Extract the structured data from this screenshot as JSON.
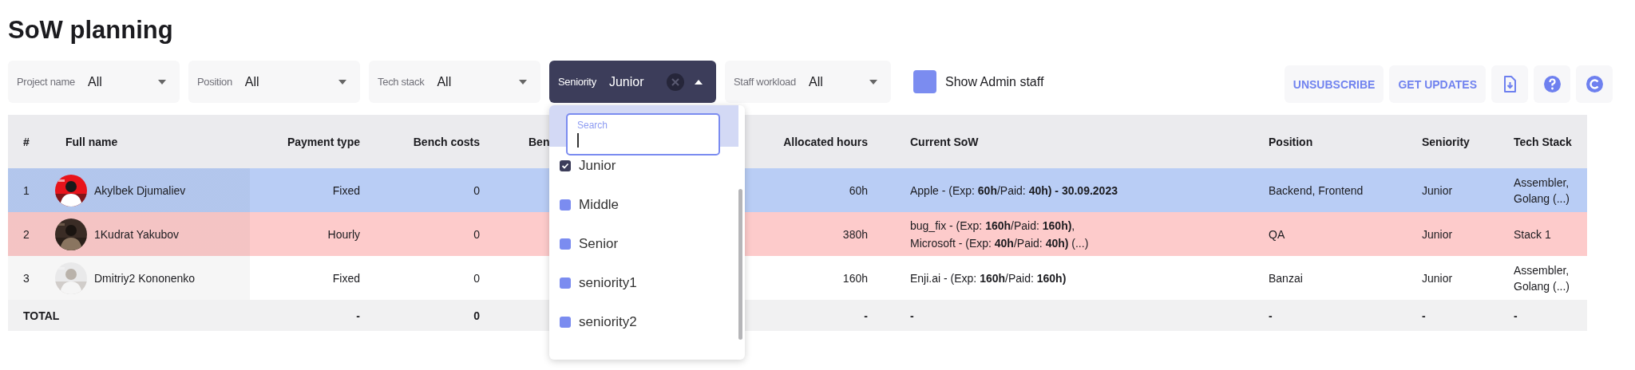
{
  "page": {
    "title": "SoW planning"
  },
  "filters": [
    {
      "label": "Project name",
      "value": "All",
      "open": false
    },
    {
      "label": "Position",
      "value": "All",
      "open": false
    },
    {
      "label": "Tech stack",
      "value": "All",
      "open": false
    },
    {
      "label": "Seniority",
      "value": "Junior",
      "open": true
    },
    {
      "label": "Staff workload",
      "value": "All",
      "open": false
    }
  ],
  "show_admin_staff": {
    "label": "Show Admin staff",
    "checked": false
  },
  "actions": [
    "UNSUBSCRIBE",
    "GET UPDATES"
  ],
  "dropdown": {
    "search_label": "Search",
    "options": [
      {
        "label": "Junior",
        "checked": true
      },
      {
        "label": "Middle",
        "checked": false
      },
      {
        "label": "Senior",
        "checked": false
      },
      {
        "label": "seniority1",
        "checked": false
      },
      {
        "label": "seniority2",
        "checked": false
      }
    ]
  },
  "table": {
    "columns": [
      "#",
      "Full name",
      "Payment type",
      "Bench costs",
      "Ben",
      "Allocated hours",
      "Current SoW",
      "Position",
      "Seniority",
      "Tech Stack"
    ],
    "rows": [
      {
        "number": "1",
        "name": "Akylbek Djumaliev",
        "payment_type": "Fixed",
        "bench_costs": "0",
        "allocated_hours": "60h",
        "current_sow": [
          "Apple - (Exp: **60h**/Paid: **40h) - 30.09.2023**"
        ],
        "position": "Backend, Frontend",
        "seniority": "Junior",
        "tech_stack": "Assembler, Golang (...)",
        "color": "#b9cdf5"
      },
      {
        "number": "2",
        "name": "1Kudrat Yakubov",
        "payment_type": "Hourly",
        "bench_costs": "0",
        "allocated_hours": "380h",
        "current_sow": [
          "bug_fix - (Exp: **160h**/Paid: **160h)**,",
          "Microsoft - (Exp: **40h**/Paid: **40h)** (...)"
        ],
        "position": "QA",
        "seniority": "Junior",
        "tech_stack": "Stack 1",
        "color": "#fdcbcb"
      },
      {
        "number": "3",
        "name": "Dmitriy2 Kononenko",
        "payment_type": "Fixed",
        "bench_costs": "0",
        "allocated_hours": "160h",
        "current_sow": [
          "Enji.ai - (Exp: **160h**/Paid: **160h)**"
        ],
        "position": "Banzai",
        "seniority": "Junior",
        "tech_stack": "Assembler, Golang (...)",
        "color": "#ffffff"
      }
    ],
    "total": {
      "label": "TOTAL",
      "payment_type": "-",
      "bench_costs": "0",
      "allocated_hours": "-",
      "current_sow": "-",
      "position": "-",
      "seniority": "-",
      "tech_stack": "-"
    }
  }
}
